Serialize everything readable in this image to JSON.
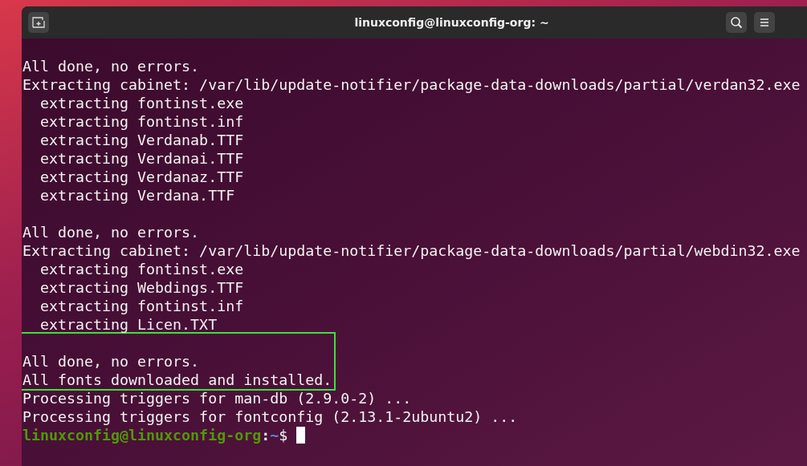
{
  "window": {
    "title": "linuxconfig@linuxconfig-org: ~"
  },
  "blocks": [
    {
      "highlighted": false,
      "lines": [
        {
          "kind": "text",
          "text": "All done, no errors."
        },
        {
          "kind": "text",
          "text": "Extracting cabinet: /var/lib/update-notifier/package-data-downloads/partial/verdan32.exe"
        },
        {
          "kind": "text",
          "text": "  extracting fontinst.exe"
        },
        {
          "kind": "text",
          "text": "  extracting fontinst.inf"
        },
        {
          "kind": "text",
          "text": "  extracting Verdanab.TTF"
        },
        {
          "kind": "text",
          "text": "  extracting Verdanai.TTF"
        },
        {
          "kind": "text",
          "text": "  extracting Verdanaz.TTF"
        },
        {
          "kind": "text",
          "text": "  extracting Verdana.TTF"
        },
        {
          "kind": "blank"
        },
        {
          "kind": "text",
          "text": "All done, no errors."
        },
        {
          "kind": "text",
          "text": "Extracting cabinet: /var/lib/update-notifier/package-data-downloads/partial/webdin32.exe"
        },
        {
          "kind": "text",
          "text": "  extracting fontinst.exe"
        },
        {
          "kind": "text",
          "text": "  extracting Webdings.TTF"
        },
        {
          "kind": "text",
          "text": "  extracting fontinst.inf"
        },
        {
          "kind": "text",
          "text": "  extracting Licen.TXT"
        }
      ]
    },
    {
      "highlighted": true,
      "lines": [
        {
          "kind": "blank"
        },
        {
          "kind": "text",
          "text": "All done, no errors."
        },
        {
          "kind": "text",
          "text": "All fonts downloaded and installed."
        }
      ]
    },
    {
      "highlighted": false,
      "lines": [
        {
          "kind": "text",
          "text": "Processing triggers for man-db (2.9.0-2) ..."
        },
        {
          "kind": "text",
          "text": "Processing triggers for fontconfig (2.13.1-2ubuntu2) ..."
        }
      ]
    }
  ],
  "prompt": {
    "user_host": "linuxconfig@linuxconfig-org",
    "separator": ":",
    "path": "~",
    "symbol": "$"
  }
}
